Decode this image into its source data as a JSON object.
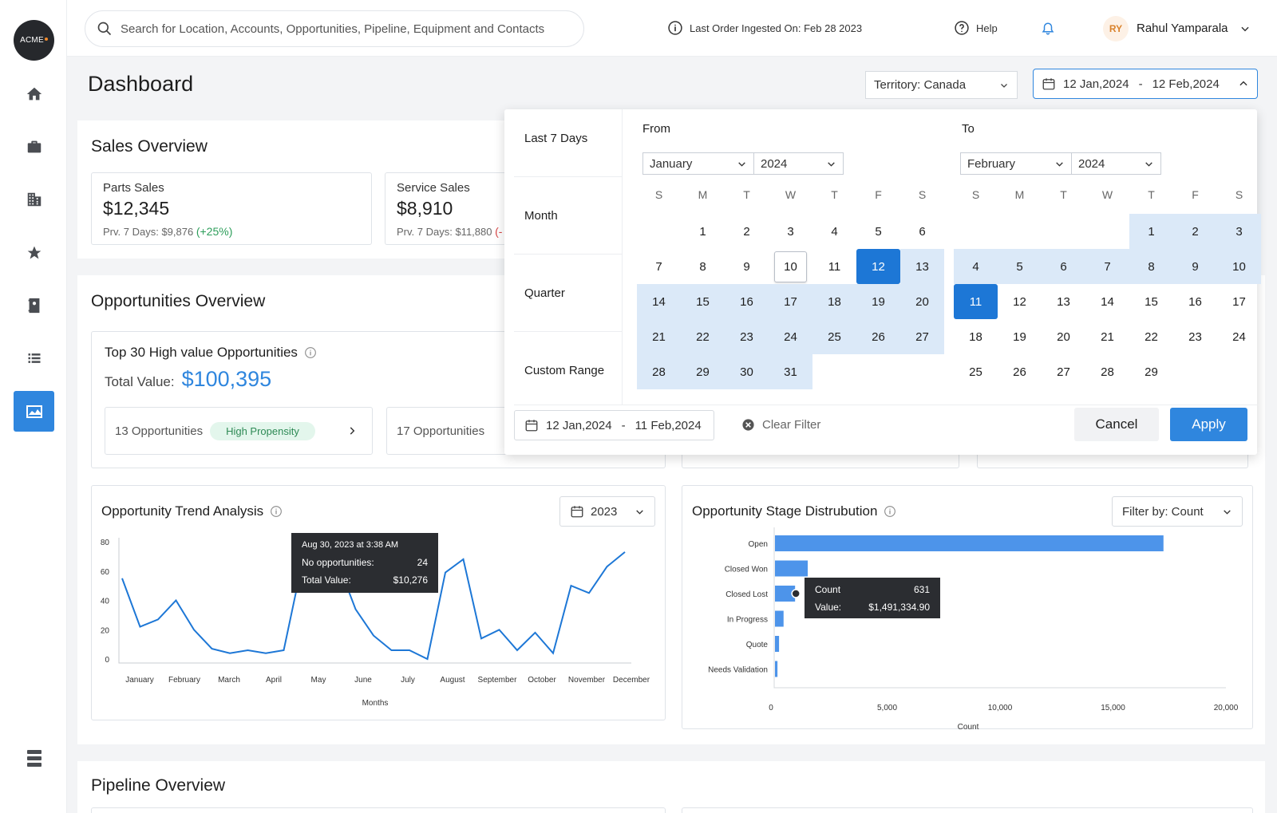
{
  "logo": {
    "text": "ACME"
  },
  "topbar": {
    "search_placeholder": "Search for Location, Accounts, Opportunities, Pipeline, Equipment and Contacts",
    "last_order": "Last Order Ingested On: Feb 28 2023",
    "help": "Help",
    "user_initials": "RY",
    "user_name": "Rahul Yamparala"
  },
  "page": {
    "title": "Dashboard",
    "territory": "Territory: Canada",
    "date_from": "12 Jan,2024",
    "date_sep": "-",
    "date_to": "12 Feb,2024"
  },
  "sales": {
    "title": "Sales Overview",
    "cards": [
      {
        "label": "Parts Sales",
        "value": "$12,345",
        "prev": "Prv. 7 Days: $9,876",
        "change": "(+25%)"
      },
      {
        "label": "Service Sales",
        "value": "$8,910",
        "prev": "Prv. 7 Days: $11,880",
        "change": "(-"
      }
    ]
  },
  "opps": {
    "title": "Opportunities Overview",
    "top_title": "Top 30 High value Opportunities",
    "total_label": "Total Value:",
    "total_value": "$100,395",
    "row1": {
      "count": "13 Opportunities",
      "badge": "High Propensity"
    },
    "row2": {
      "count": "17 Opportunities"
    }
  },
  "date_picker": {
    "presets": [
      "Last 7 Days",
      "Month",
      "Quarter",
      "Custom Range"
    ],
    "from_label": "From",
    "to_label": "To",
    "from_month": "January",
    "from_year": "2024",
    "to_month": "February",
    "to_year": "2024",
    "weekdays": [
      "S",
      "M",
      "T",
      "W",
      "T",
      "F",
      "S"
    ],
    "range_from": "12 Jan,2024",
    "range_sep": "-",
    "range_to": "11 Feb,2024",
    "clear": "Clear Filter",
    "cancel": "Cancel",
    "apply": "Apply"
  },
  "trend": {
    "title": "Opportunity Trend Analysis",
    "year": "2023",
    "tooltip": {
      "date": "Aug 30, 2023 at 3:38 AM",
      "opps_label": "No opportunities:",
      "opps_value": "24",
      "value_label": "Total Value:",
      "value_value": "$10,276"
    }
  },
  "stage": {
    "title": "Opportunity Stage Distrubution",
    "filter": "Filter by: Count",
    "tooltip": {
      "count_label": "Count",
      "count_value": "631",
      "value_label": "Value:",
      "value_value": "$1,491,334.90"
    }
  },
  "pipeline": {
    "title": "Pipeline Overview"
  },
  "chart_data": [
    {
      "type": "line",
      "xlabel": "Months",
      "ylabel": "",
      "categories": [
        "January",
        "February",
        "March",
        "April",
        "May",
        "June",
        "July",
        "August",
        "September",
        "October",
        "November",
        "December"
      ],
      "ylim": [
        0,
        80
      ],
      "yticks": [
        0,
        20,
        40,
        60,
        80
      ],
      "x": [
        0,
        0.55,
        1,
        1.4,
        1.8,
        2.15,
        2.6,
        3,
        3.3,
        3.75,
        4.2,
        4.75,
        5.3,
        5.8,
        6.3,
        6.75,
        7.2,
        7.55,
        8,
        8.6,
        9.1,
        9.7,
        10.2,
        10.7,
        11.1,
        11.55
      ],
      "series": [
        {
          "values": [
            55,
            22,
            27,
            40,
            20,
            7,
            4,
            6,
            4,
            6,
            64,
            76,
            66,
            34,
            16,
            6,
            6,
            0,
            59,
            68,
            14,
            20,
            6,
            18,
            4,
            50,
            45,
            63,
            73
          ]
        }
      ],
      "grid": false
    },
    {
      "type": "bar",
      "orientation": "horizontal",
      "xlabel": "Count",
      "categories": [
        "Open",
        "Closed Won",
        "Closed Lost",
        "In Progress",
        "Quote",
        "Needs Validation"
      ],
      "values": [
        17200,
        1450,
        890,
        380,
        180,
        110
      ],
      "xlim": [
        0,
        20000
      ],
      "xticks": [
        0,
        5000,
        10000,
        15000,
        20000
      ],
      "grid": false
    }
  ]
}
